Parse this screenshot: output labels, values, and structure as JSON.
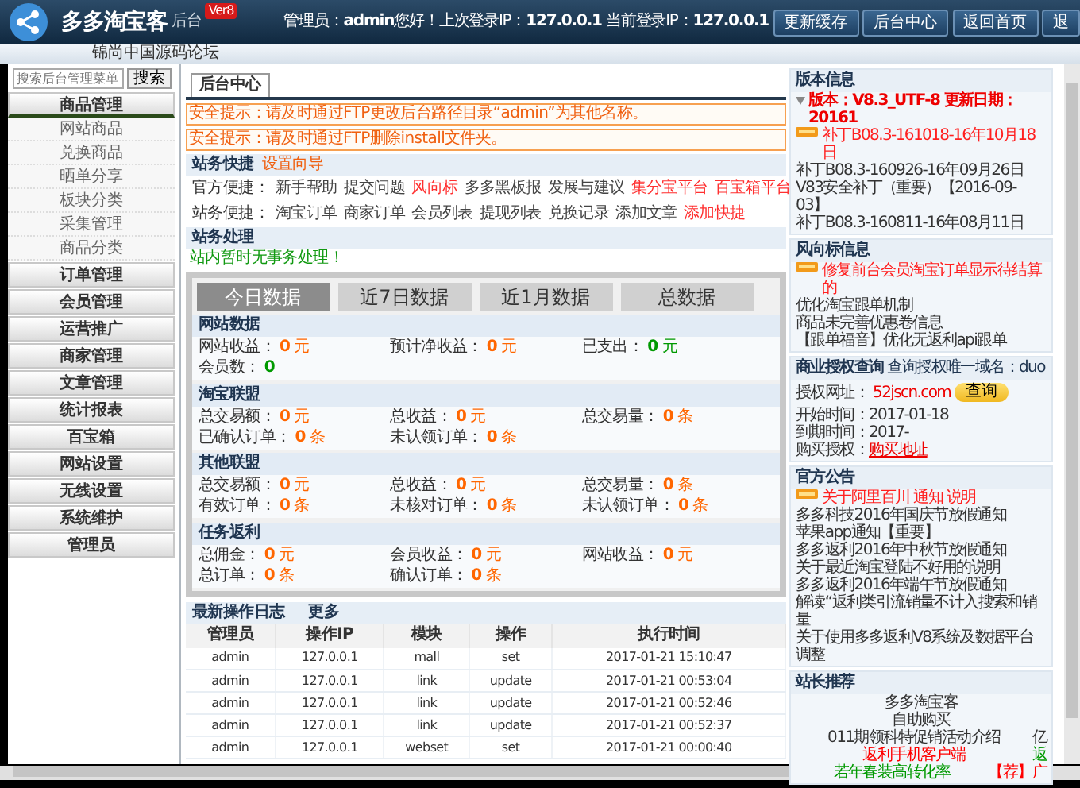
{
  "header": {
    "logo_title": "多多淘宝客",
    "logo_sub": "后台",
    "version_badge": "Ver8",
    "site_name": "锦尚中国源码论坛",
    "admin_label": "管理员：",
    "admin_name": "admin",
    "greeting": "您好！上次登录IP：",
    "last_ip": "127.0.0.1",
    "current_label": "当前登录IP：",
    "current_ip": "127.0.0.1",
    "buttons": [
      "更新缓存",
      "后台中心",
      "返回首页",
      "退"
    ]
  },
  "sidebar": {
    "search": {
      "placeholder": "搜索后台管理菜单"
    },
    "search_button": "搜索",
    "groups": [
      {
        "label": "商品管理",
        "expanded": true,
        "children": [
          {
            "label": "网站商品"
          },
          {
            "label": "兑换商品"
          },
          {
            "label": "晒单分享"
          },
          {
            "label": "板块分类"
          },
          {
            "label": "采集管理"
          },
          {
            "label": "商品分类"
          }
        ]
      },
      {
        "label": "订单管理",
        "expanded": false
      },
      {
        "label": "会员管理",
        "expanded": false
      },
      {
        "label": "运营推广",
        "expanded": false
      },
      {
        "label": "商家管理",
        "expanded": false
      },
      {
        "label": "文章管理",
        "expanded": false
      },
      {
        "label": "统计报表",
        "expanded": false
      },
      {
        "label": "百宝箱",
        "expanded": false
      },
      {
        "label": "网站设置",
        "expanded": false
      },
      {
        "label": "无线设置",
        "expanded": false
      },
      {
        "label": "系统维护",
        "expanded": false
      },
      {
        "label": "管理员",
        "expanded": false
      }
    ]
  },
  "tabs": [
    {
      "label": "后台中心",
      "selected": true
    }
  ],
  "warnings": [
    "安全提示：请及时通过FTP更改后台路径目录“admin”为其他名称。",
    "安全提示：请及时通过FTP删除install文件夹。"
  ],
  "shortcuts": {
    "title": "站务快捷",
    "setup_link": "设置向导",
    "rows": [
      {
        "label": "官方便捷：",
        "links": [
          {
            "text": "新手帮助",
            "highlight": false
          },
          {
            "text": "提交问题",
            "highlight": false
          },
          {
            "text": "风向标",
            "highlight": true
          },
          {
            "text": "多多黑板报",
            "highlight": false
          },
          {
            "text": "发展与建议",
            "highlight": false
          },
          {
            "text": "集分宝平台",
            "highlight": true
          },
          {
            "text": "百宝箱平台",
            "highlight": true
          }
        ]
      },
      {
        "label": "站务便捷：",
        "links": [
          {
            "text": "淘宝订单",
            "highlight": false
          },
          {
            "text": "商家订单",
            "highlight": false
          },
          {
            "text": "会员列表",
            "highlight": false
          },
          {
            "text": "提现列表",
            "highlight": false
          },
          {
            "text": "兑换记录",
            "highlight": false
          },
          {
            "text": "添加文章",
            "highlight": false
          },
          {
            "text": "添加快捷",
            "highlight": true
          }
        ]
      }
    ]
  },
  "tasks": {
    "title": "站务处理",
    "message": "站内暂时无事务处理！"
  },
  "stats": {
    "tabs": [
      {
        "label": "今日数据",
        "selected": true
      },
      {
        "label": "近7日数据",
        "selected": false
      },
      {
        "label": "近1月数据",
        "selected": false
      },
      {
        "label": "总数据",
        "selected": false
      }
    ],
    "sections": [
      {
        "title": "网站数据",
        "items": [
          {
            "label": "网站收益：",
            "value": "0",
            "unit": "元",
            "color": "#ff6600"
          },
          {
            "label": "预计净收益：",
            "value": "0",
            "unit": "元",
            "color": "#ff6600"
          },
          {
            "label": "已支出：",
            "value": "0",
            "unit": "元",
            "color": "#009900"
          },
          {
            "label": "会员数：",
            "value": "0",
            "color": "#009900"
          }
        ]
      },
      {
        "title": "淘宝联盟",
        "items": [
          {
            "label": "总交易额：",
            "value": "0",
            "unit": "元",
            "color": "#ff6600"
          },
          {
            "label": "总收益：",
            "value": "0",
            "unit": "元",
            "color": "#ff6600"
          },
          {
            "label": "总交易量：",
            "value": "0",
            "unit": "条",
            "color": "#ff6600"
          },
          {
            "label": "已确认订单：",
            "value": "0",
            "unit": "条",
            "color": "#ff6600"
          },
          {
            "label": "未认领订单：",
            "value": "0",
            "unit": "条",
            "color": "#ff6600"
          }
        ]
      },
      {
        "title": "其他联盟",
        "items": [
          {
            "label": "总交易额：",
            "value": "0",
            "unit": "元",
            "color": "#ff6600"
          },
          {
            "label": "总收益：",
            "value": "0",
            "unit": "元",
            "color": "#ff6600"
          },
          {
            "label": "总交易量：",
            "value": "0",
            "unit": "条",
            "color": "#ff6600"
          },
          {
            "label": "有效订单：",
            "value": "0",
            "unit": "条",
            "color": "#ff6600"
          },
          {
            "label": "未核对订单：",
            "value": "0",
            "unit": "条",
            "color": "#ff6600"
          },
          {
            "label": "未认领订单：",
            "value": "0",
            "unit": "条",
            "color": "#ff6600"
          }
        ]
      },
      {
        "title": "任务返利",
        "items": [
          {
            "label": "总佣金：",
            "value": "0",
            "unit": "元",
            "color": "#ff6600"
          },
          {
            "label": "会员收益：",
            "value": "0",
            "unit": "元",
            "color": "#ff6600"
          },
          {
            "label": "网站收益：",
            "value": "0",
            "unit": "元",
            "color": "#ff6600"
          },
          {
            "label": "总订单：",
            "value": "0",
            "unit": "条",
            "color": "#ff6600"
          },
          {
            "label": "确认订单：",
            "value": "0",
            "unit": "条",
            "color": "#ff6600"
          }
        ]
      }
    ]
  },
  "log": {
    "title": "最新操作日志",
    "more": "更多",
    "columns": [
      "管理员",
      "操作IP",
      "模块",
      "操作",
      "执行时间"
    ],
    "rows": [
      [
        "admin",
        "127.0.0.1",
        "mall",
        "set",
        "2017-01-21 15:10:47"
      ],
      [
        "admin",
        "127.0.0.1",
        "link",
        "update",
        "2017-01-21 00:53:04"
      ],
      [
        "admin",
        "127.0.0.1",
        "link",
        "update",
        "2017-01-21 00:52:46"
      ],
      [
        "admin",
        "127.0.0.1",
        "link",
        "update",
        "2017-01-21 00:52:37"
      ],
      [
        "admin",
        "127.0.0.1",
        "webset",
        "set",
        "2017-01-21 00:00:40"
      ]
    ]
  },
  "version_info": {
    "title": "版本信息",
    "current": "版本：V8.3_UTF-8 更新日期：20161",
    "patches": [
      {
        "text": "补丁B08.3-161018-16年10月18日",
        "new": true
      },
      {
        "text": "补丁B08.3-160926-16年09月26日",
        "new": false
      },
      {
        "text": "V83安全补丁（重要）【2016-09-03】",
        "new": false
      },
      {
        "text": "补丁B08.3-160811-16年08月11日",
        "new": false
      }
    ]
  },
  "trend_info": {
    "title": "风向标信息",
    "items": [
      {
        "text": "修复前台会员淘宝订单显示待结算的",
        "new": true
      },
      {
        "text": "优化淘宝跟单机制",
        "new": false
      },
      {
        "text": "商品未完善优惠卷信息",
        "new": false
      },
      {
        "text": "【跟单福音】优化无返利api跟单",
        "new": false
      }
    ]
  },
  "license": {
    "title": "商业授权查询",
    "note": "查询授权唯一域名：duo",
    "site_label": "授权网址：",
    "site": "52jscn.com",
    "query_button": "查询",
    "start_label": "开始时间：",
    "start": "2017-01-18",
    "end_label": "到期时间：",
    "end": "2017-",
    "buy_label": "购买授权：",
    "buy_link": "购买地址"
  },
  "announcements": {
    "title": "官方公告",
    "items": [
      {
        "text": "关于阿里百川 通知 说明",
        "new": true
      },
      {
        "text": "多多科技2016年国庆节放假通知",
        "new": false
      },
      {
        "text": "苹果app通知【重要】",
        "new": false
      },
      {
        "text": "多多返利2016年中秋节放假通知",
        "new": false
      },
      {
        "text": "关于最近淘宝登陆不好用的说明",
        "new": false
      },
      {
        "text": "多多返利2016年端午节放假通知",
        "new": false
      },
      {
        "text": "解读“返利类引流销量不计入搜索和销量",
        "new": false
      },
      {
        "text": "关于使用多多返利V8系统及数据平台调整",
        "new": false
      }
    ]
  },
  "recommend": {
    "title": "站长推荐",
    "rows": [
      [
        {
          "text": "多多淘宝客",
          "color": "#333333"
        }
      ],
      [
        {
          "text": "自助购买",
          "color": "#333333"
        }
      ],
      [
        {
          "text": "011期领科特促销活动介绍",
          "color": "#333333"
        },
        {
          "text": "亿",
          "color": "#333333"
        }
      ],
      [
        {
          "text": "返利手机客户端",
          "color": "#ff0000"
        },
        {
          "text": "返",
          "color": "#009900"
        }
      ],
      [
        {
          "text": "若年春装高转化率",
          "color": "#009900"
        },
        {
          "text": "【荐】广",
          "color": "#ff0000"
        }
      ]
    ]
  }
}
